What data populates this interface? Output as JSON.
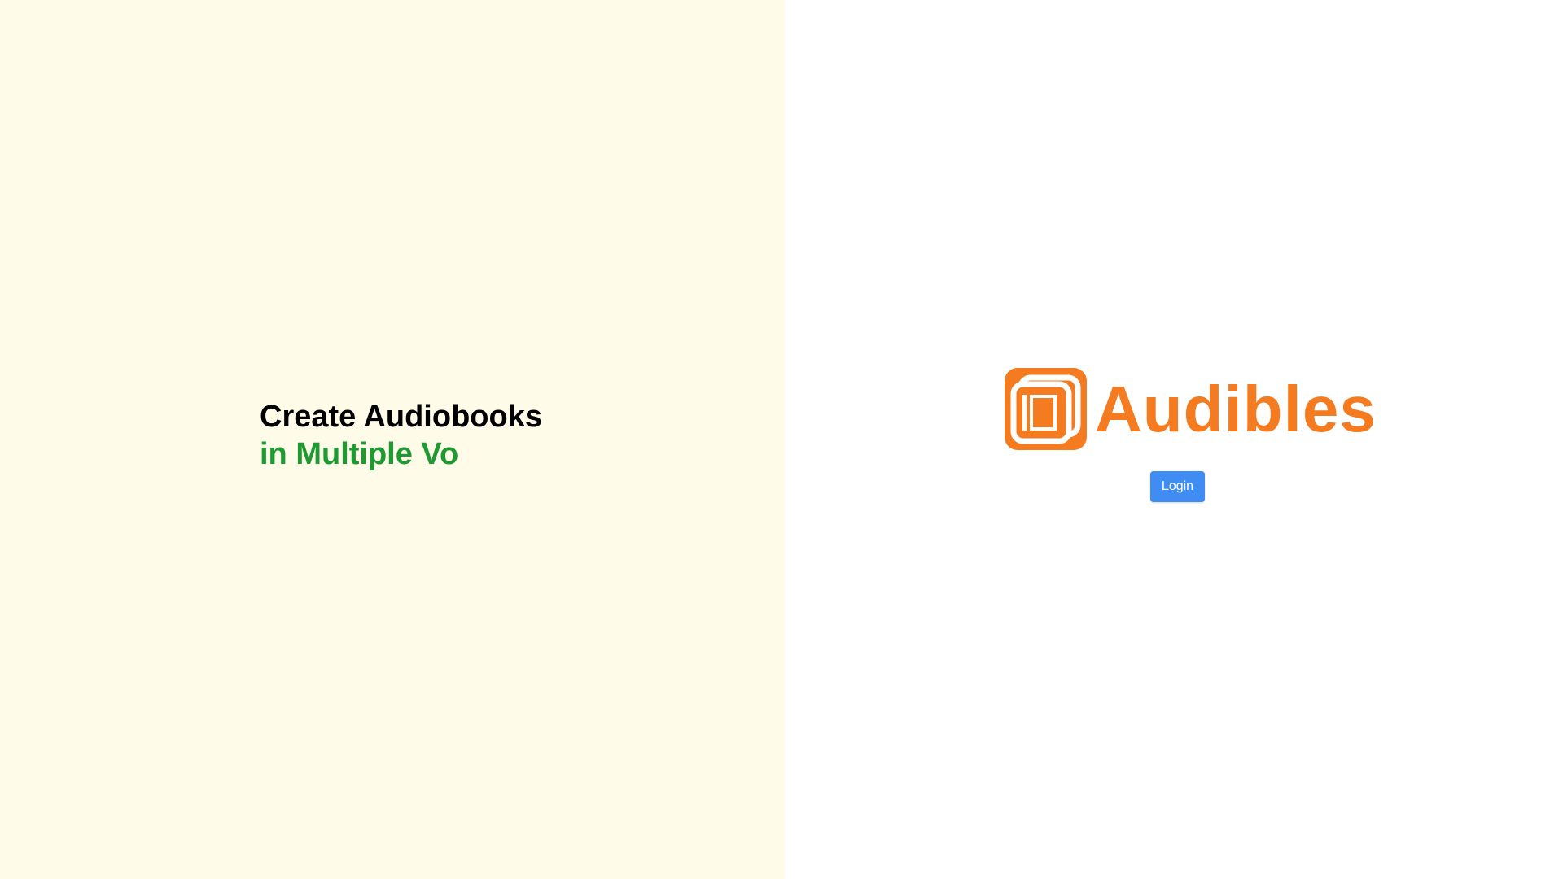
{
  "hero": {
    "line1": "Create Audiobooks",
    "line2": "in Multiple Vo"
  },
  "brand": {
    "name": "Audibles",
    "logo_icon": "book-stack-icon"
  },
  "auth": {
    "login_label": "Login"
  },
  "colors": {
    "left_background": "#fefbe8",
    "right_background": "#ffffff",
    "heading_text": "#000000",
    "accent_green": "#1f9a33",
    "brand_orange": "#f47b20",
    "button_blue": "#3f8cf3"
  }
}
